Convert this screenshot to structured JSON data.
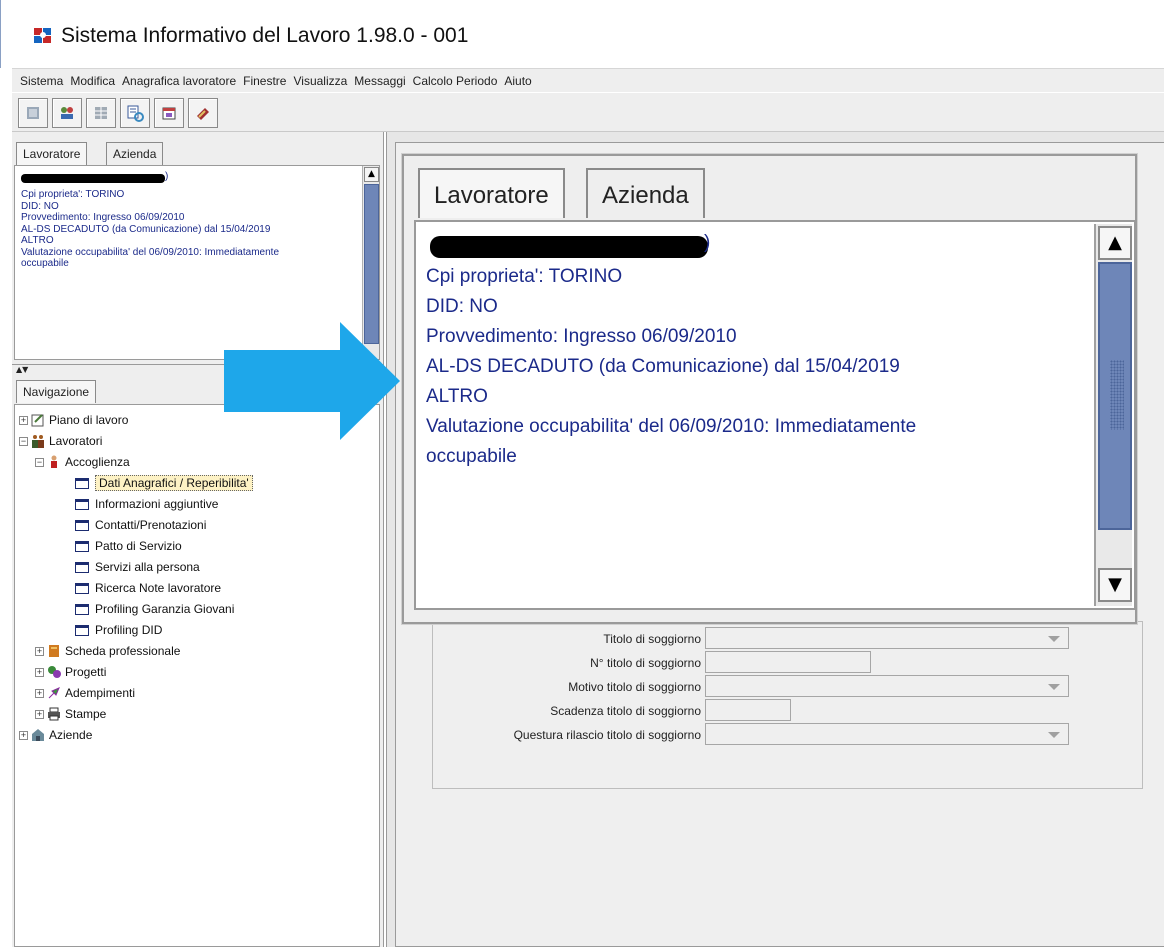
{
  "window": {
    "title": "Sistema Informativo del Lavoro 1.98.0 - 001"
  },
  "menu": [
    "Sistema",
    "Modifica",
    "Anagrafica lavoratore",
    "Finestre",
    "Visualizza",
    "Messaggi",
    "Calcolo Periodo",
    "Aiuto"
  ],
  "left_tabs": {
    "lavoratore": "Lavoratore",
    "azienda": "Azienda",
    "navigazione": "Navigazione"
  },
  "info": {
    "cpi": "Cpi proprieta': TORINO",
    "did": "DID: NO",
    "provvedimento": "Provvedimento: Ingresso 06/09/2010",
    "stato": "AL-DS DECADUTO (da Comunicazione) dal 15/04/2019",
    "altro": "ALTRO",
    "valutazione": "Valutazione occupabilita' del 06/09/2010: Immediatamente",
    "valutazione_cont": "occupabile",
    "name_suffix": ")"
  },
  "tree": {
    "piano": "Piano di lavoro",
    "lavoratori": "Lavoratori",
    "accoglienza": "Accoglienza",
    "dati": "Dati Anagrafici / Reperibilita'",
    "informazioni": "Informazioni aggiuntive",
    "contatti": "Contatti/Prenotazioni",
    "patto": "Patto di Servizio",
    "servizi": "Servizi alla persona",
    "ricerca": "Ricerca Note lavoratore",
    "profiling_gg": "Profiling Garanzia Giovani",
    "profiling_did": "Profiling DID",
    "scheda": "Scheda professionale",
    "progetti": "Progetti",
    "adempimenti": "Adempimenti",
    "stampe": "Stampe",
    "aziende": "Aziende"
  },
  "form": {
    "titolo": "Titolo di soggiorno",
    "numero": "N° titolo di soggiorno",
    "motivo": "Motivo titolo di soggiorno",
    "scadenza": "Scadenza titolo di soggiorno",
    "questura": "Questura rilascio titolo di soggiorno"
  },
  "colors": {
    "info_text": "#1b2a8a",
    "arrow": "#1ea7ea",
    "scroll_thumb": "#6e86b8"
  }
}
